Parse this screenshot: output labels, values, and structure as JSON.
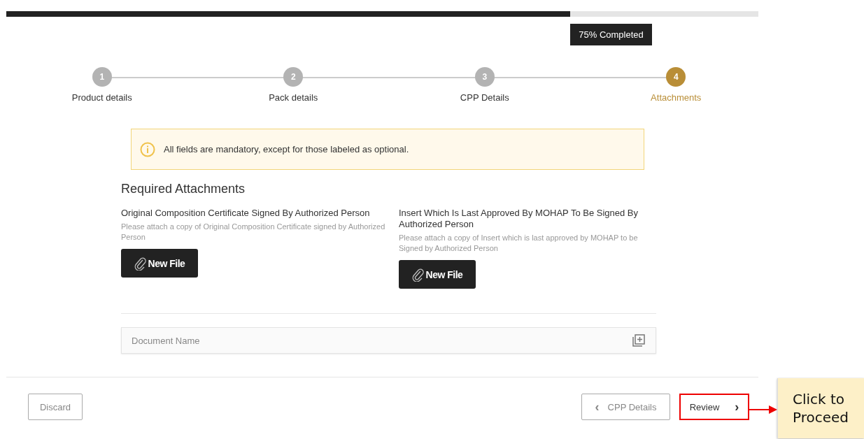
{
  "progress": {
    "level": 0.75,
    "label": "75% Completed"
  },
  "steps": [
    {
      "number": "1",
      "label": "Product details",
      "selected": false
    },
    {
      "number": "2",
      "label": "Pack details",
      "selected": false
    },
    {
      "number": "3",
      "label": "CPP Details",
      "selected": false
    },
    {
      "number": "4",
      "label": "Attachments",
      "selected": true
    }
  ],
  "alert": {
    "text": "All fields are mandatory, except for those labeled as optional."
  },
  "section_title": "Required Attachments",
  "attachments": [
    {
      "title": "Original Composition Certificate Signed By Authorized Person",
      "hint": "Please attach a copy of Original Composition Certificate signed by Authorized Person",
      "button": "New File"
    },
    {
      "title": "Insert Which Is Last Approved By MOHAP To Be Signed By Authorized Person",
      "hint": "Please attach a copy of Insert which is last approved by MOHAP to be Signed by Authorized Person",
      "button": "New File"
    }
  ],
  "document_field": {
    "placeholder": "Document Name"
  },
  "footer": {
    "discard": "Discard",
    "back": {
      "arrow": "‹",
      "label": "CPP Details"
    },
    "next": {
      "label": "Review",
      "arrow": "›",
      "highlighted": true
    }
  },
  "callout": {
    "text": "Click to Proceed"
  }
}
